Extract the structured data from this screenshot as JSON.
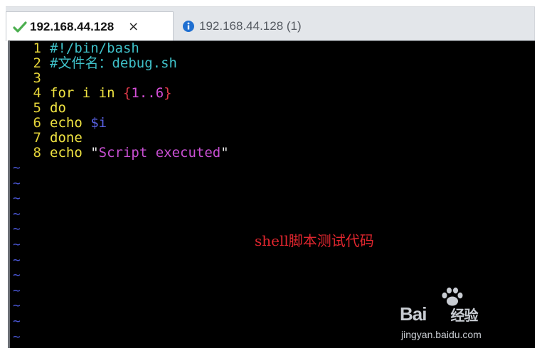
{
  "tabs": [
    {
      "title": "192.168.44.128",
      "close_label": "×",
      "icon": "check-icon",
      "active": true
    },
    {
      "title": "192.168.44.128 (1)",
      "icon": "info-icon",
      "active": false
    }
  ],
  "editor": {
    "lines": [
      {
        "n": "1",
        "text": "#!/bin/bash"
      },
      {
        "n": "2",
        "text": "#文件名：debug.sh"
      },
      {
        "n": "3",
        "text": ""
      },
      {
        "n": "4",
        "kw": "for i in ",
        "brace_open": "{",
        "range": "1..6",
        "brace_close": "}"
      },
      {
        "n": "5",
        "kw": "do"
      },
      {
        "n": "6",
        "kw": "echo ",
        "var": "$i"
      },
      {
        "n": "7",
        "kw": "done"
      },
      {
        "n": "8",
        "kw": "echo ",
        "q1": "\"",
        "str": "Script executed",
        "q2": "\""
      }
    ],
    "tilde": "~"
  },
  "annotation": "shell脚本测试代码",
  "watermark": {
    "brand": "Bai",
    "brand2": "经验",
    "url": "jingyan.baidu.com"
  },
  "colors": {
    "terminal_bg": "#000000",
    "line_number": "#e6d53a",
    "comment": "#3fc1c9",
    "keyword": "#f0e442",
    "string": "#c94fd3",
    "variable": "#5a63e6",
    "tilde": "#4a57d6",
    "annotation": "#e0262e"
  }
}
